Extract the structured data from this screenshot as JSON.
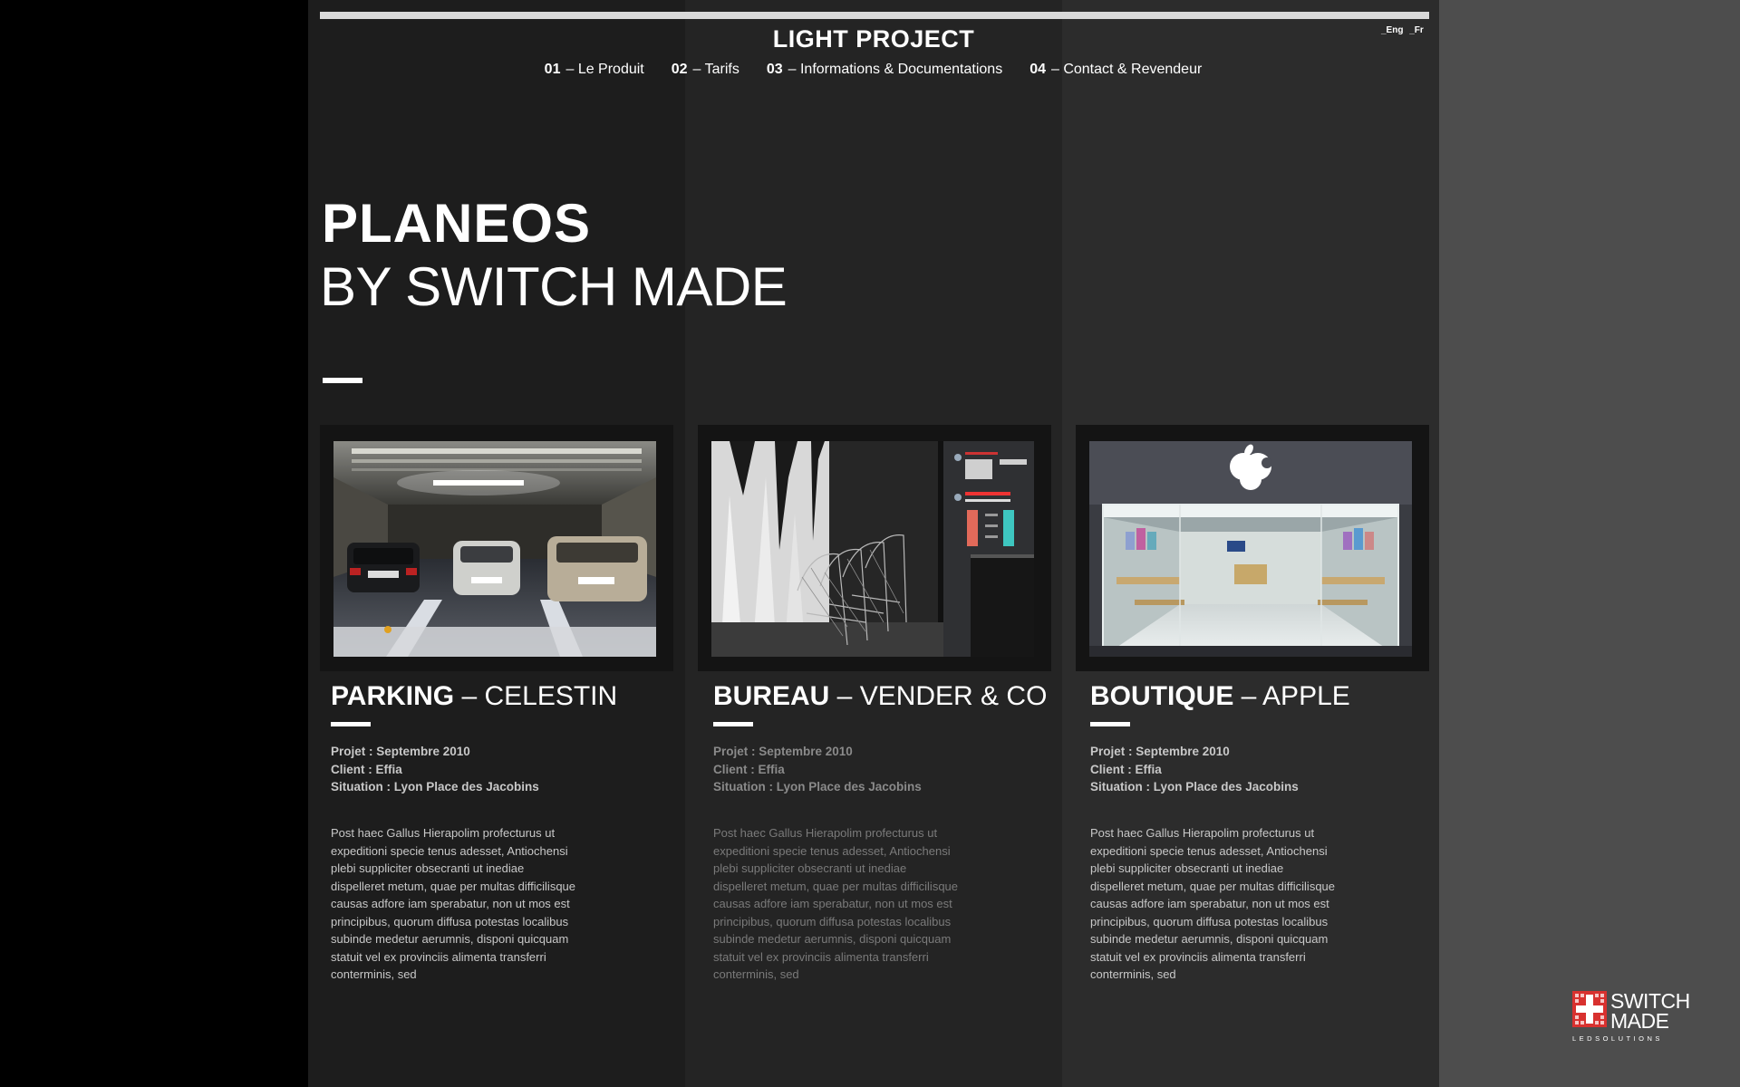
{
  "header": {
    "site_title": "LIGHT PROJECT",
    "lang_en": "_Eng",
    "lang_fr": "_Fr"
  },
  "nav": {
    "items": [
      {
        "num": "01",
        "label": "– Le Produit"
      },
      {
        "num": "02",
        "label": "– Tarifs"
      },
      {
        "num": "03",
        "label": "– Informations & Documentations"
      },
      {
        "num": "04",
        "label": "– Contact & Revendeur"
      }
    ]
  },
  "hero": {
    "title": "PLANEOS",
    "subtitle": "BY SWITCH MADE"
  },
  "cards": [
    {
      "title_bold": "PARKING",
      "title_rest": " – CELESTIN",
      "image_icon": "parking-garage-photo",
      "projet": "Projet : Septembre 2010",
      "client": "Client : Effia",
      "situation": "Situation : Lyon Place des Jacobins",
      "body": "Post haec Gallus Hierapolim profecturus ut expeditioni specie tenus adesset, Antiochensi plebi suppliciter obsecranti ut inediae dispelleret metum, quae per multas difficilisque causas adfore iam sperabatur, non ut mos est principibus, quorum diffusa potestas localibus subinde medetur aerumnis, disponi quicquam statuit vel ex provinciis alimenta transferri conterminis, sed"
    },
    {
      "title_bold": "BUREAU",
      "title_rest": " – VENDER & CO",
      "image_icon": "office-chairs-photo",
      "projet": "Projet : Septembre 2010",
      "client": "Client : Effia",
      "situation": "Situation : Lyon Place des Jacobins",
      "body": "Post haec Gallus Hierapolim profecturus ut expeditioni specie tenus adesset, Antiochensi plebi suppliciter obsecranti ut inediae dispelleret metum, quae per multas difficilisque causas adfore iam sperabatur, non ut mos est principibus, quorum diffusa potestas localibus subinde medetur aerumnis, disponi quicquam statuit vel ex provinciis alimenta transferri conterminis, sed"
    },
    {
      "title_bold": "BOUTIQUE",
      "title_rest": " – APPLE",
      "image_icon": "apple-store-photo",
      "projet": "Projet : Septembre 2010",
      "client": "Client : Effia",
      "situation": "Situation : Lyon Place des Jacobins",
      "body": "Post haec Gallus Hierapolim profecturus ut expeditioni specie tenus adesset, Antiochensi plebi suppliciter obsecranti ut inediae dispelleret metum, quae per multas difficilisque causas adfore iam sperabatur, non ut mos est principibus, quorum diffusa potestas localibus subinde medetur aerumnis, disponi quicquam statuit vel ex provinciis alimenta transferri conterminis, sed"
    }
  ],
  "logo": {
    "line1": "SWITCH",
    "line2": "MADE",
    "tagline": "LEDSOLUTIONS"
  },
  "colors": {
    "accent": "#ffffff",
    "logo_red": "#d8312f"
  }
}
